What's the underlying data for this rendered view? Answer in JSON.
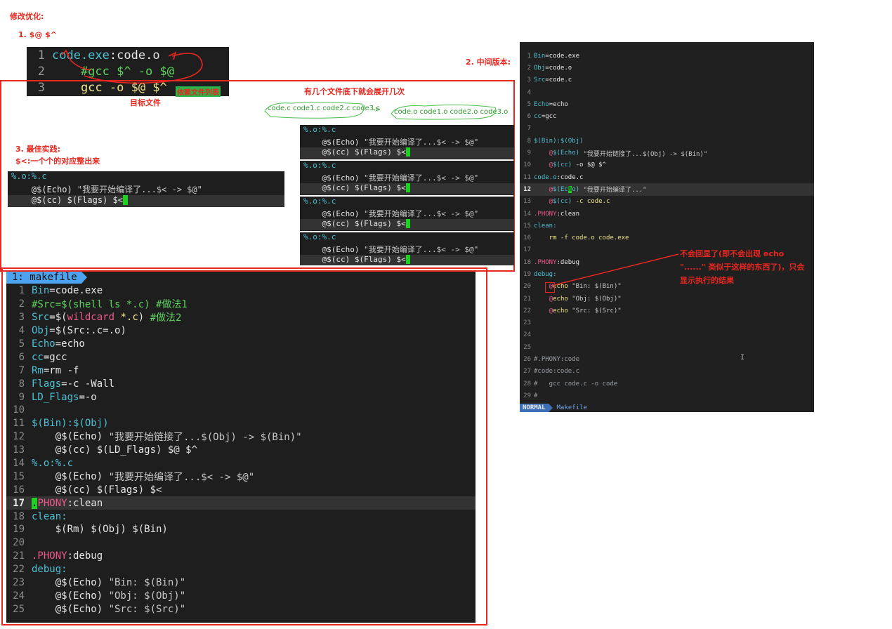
{
  "annotations": {
    "heading": "修改优化:",
    "step1": "1. $@ $^",
    "deps_label": "依赖文件列表",
    "target_label": "目标文件",
    "step2": "2. 中间版本:",
    "expand_note": "有几个文件底下就会展开几次",
    "src_files": "code.c code1.c code2.c code3.c",
    "arrow": "->",
    "obj_files": "code.o code1.o code2.o code3.o",
    "step3": "3. 最佳实践:",
    "step3_sub": "$<:一个个的对应整出来",
    "no_echo_note_1": "不会回显了(即不会出现 echo",
    "no_echo_note_2": "\"......\" 类似于这样的东西了)，只会",
    "no_echo_note_3": "显示执行的结果"
  },
  "snippet1": {
    "lines": [
      {
        "n": "1",
        "a": "code.exe",
        "b": ":",
        "c": "code.o"
      },
      {
        "n": "2",
        "t": "    #gcc $^ -o $@"
      },
      {
        "n": "3",
        "t": "    gcc -o $@ $^"
      }
    ]
  },
  "pattern_block": {
    "l1": "%.o:%.c",
    "l2a": "    @$(Echo) ",
    "l2b": "\"我要开始编译了...$< -> $@\"",
    "l3": "    @$(cc) $(Flags) $<"
  },
  "main_editor": {
    "tab_label": "1: makefile",
    "lines": [
      {
        "n": "1",
        "p": [
          [
            "c-cyan",
            "Bin"
          ],
          [
            "c-white",
            "=code.exe"
          ]
        ]
      },
      {
        "n": "2",
        "p": [
          [
            "c-green",
            "#Src=$(shell ls *.c) #做法1"
          ]
        ]
      },
      {
        "n": "3",
        "p": [
          [
            "c-cyan",
            "Src"
          ],
          [
            "c-white",
            "=$("
          ],
          [
            "c-pink",
            "wildcard"
          ],
          [
            "c-white",
            " "
          ],
          [
            "c-yellow",
            "*.c"
          ],
          [
            "c-white",
            ") "
          ],
          [
            "c-green",
            "#做法2"
          ]
        ]
      },
      {
        "n": "4",
        "p": [
          [
            "c-cyan",
            "Obj"
          ],
          [
            "c-white",
            "=$(Src:.c=.o)"
          ]
        ]
      },
      {
        "n": "5",
        "p": [
          [
            "c-cyan",
            "Echo"
          ],
          [
            "c-white",
            "=echo"
          ]
        ]
      },
      {
        "n": "6",
        "p": [
          [
            "c-cyan",
            "cc"
          ],
          [
            "c-white",
            "=gcc"
          ]
        ]
      },
      {
        "n": "7",
        "p": [
          [
            "c-cyan",
            "Rm"
          ],
          [
            "c-white",
            "=rm -f"
          ]
        ]
      },
      {
        "n": "8",
        "p": [
          [
            "c-cyan",
            "Flags"
          ],
          [
            "c-white",
            "=-c -Wall"
          ]
        ]
      },
      {
        "n": "9",
        "p": [
          [
            "c-cyan",
            "LD_Flags"
          ],
          [
            "c-white",
            "=-o"
          ]
        ]
      },
      {
        "n": "10",
        "p": []
      },
      {
        "n": "11",
        "p": [
          [
            "c-cyan",
            "$(Bin):$(Obj)"
          ]
        ]
      },
      {
        "n": "12",
        "p": [
          [
            "c-white",
            "    @$(Echo) "
          ],
          [
            "c-lt",
            "\"我要开始链接了...$(Obj) -> $(Bin)\""
          ]
        ]
      },
      {
        "n": "13",
        "p": [
          [
            "c-white",
            "    @$(cc) $(LD_Flags) $@ $^"
          ]
        ]
      },
      {
        "n": "14",
        "p": [
          [
            "c-cyan",
            "%.o:%.c"
          ]
        ]
      },
      {
        "n": "15",
        "p": [
          [
            "c-white",
            "    @$(Echo) "
          ],
          [
            "c-lt",
            "\"我要开始编译了...$< -> $@\""
          ]
        ]
      },
      {
        "n": "16",
        "p": [
          [
            "c-white",
            "    @$(cc) $(Flags) $<"
          ]
        ]
      },
      {
        "n": "17",
        "p": [
          [
            "cursor",
            "."
          ],
          [
            "c-pink",
            "PHONY"
          ],
          [
            "c-white",
            ":clean"
          ]
        ],
        "hl": true
      },
      {
        "n": "18",
        "p": [
          [
            "c-cyan",
            "clean:"
          ]
        ]
      },
      {
        "n": "19",
        "p": [
          [
            "c-white",
            "    $(Rm) $(Obj) $(Bin)"
          ]
        ]
      },
      {
        "n": "20",
        "p": []
      },
      {
        "n": "21",
        "p": [
          [
            "c-pink",
            ".PHONY"
          ],
          [
            "c-white",
            ":debug"
          ]
        ]
      },
      {
        "n": "22",
        "p": [
          [
            "c-cyan",
            "debug:"
          ]
        ]
      },
      {
        "n": "23",
        "p": [
          [
            "c-white",
            "    @$(Echo) "
          ],
          [
            "c-lt",
            "\"Bin: $(Bin)\""
          ]
        ]
      },
      {
        "n": "24",
        "p": [
          [
            "c-white",
            "    @$(Echo) "
          ],
          [
            "c-lt",
            "\"Obj: $(Obj)\""
          ]
        ]
      },
      {
        "n": "25",
        "p": [
          [
            "c-white",
            "    @$(Echo) "
          ],
          [
            "c-lt",
            "\"Src: $(Src)\""
          ]
        ]
      }
    ]
  },
  "right_editor": {
    "mode": "NORMAL",
    "filename": "Makefile",
    "lines": [
      {
        "n": "1",
        "p": [
          [
            "c-cyan",
            "Bin"
          ],
          [
            "c-white",
            "=code.exe"
          ]
        ]
      },
      {
        "n": "2",
        "p": [
          [
            "c-cyan",
            "Obj"
          ],
          [
            "c-white",
            "=code.o"
          ]
        ]
      },
      {
        "n": "3",
        "p": [
          [
            "c-cyan",
            "Src"
          ],
          [
            "c-white",
            "=code.c"
          ]
        ]
      },
      {
        "n": "4",
        "p": []
      },
      {
        "n": "5",
        "p": [
          [
            "c-cyan",
            "Echo"
          ],
          [
            "c-white",
            "=echo"
          ]
        ]
      },
      {
        "n": "6",
        "p": [
          [
            "c-cyan",
            "cc"
          ],
          [
            "c-white",
            "=gcc"
          ]
        ]
      },
      {
        "n": "7",
        "p": []
      },
      {
        "n": "8",
        "p": [
          [
            "c-cyan",
            "$(Bin):$(Obj)"
          ]
        ]
      },
      {
        "n": "9",
        "p": [
          [
            "c-white",
            "    "
          ],
          [
            "c-pink",
            "@"
          ],
          [
            "c-cyan",
            "$(Echo)"
          ],
          [
            "c-lt",
            " \"我要开始链接了...$(Obj) -> $(Bin)\""
          ]
        ]
      },
      {
        "n": "10",
        "p": [
          [
            "c-white",
            "    "
          ],
          [
            "c-pink",
            "@"
          ],
          [
            "c-cyan",
            "$(cc)"
          ],
          [
            "c-white",
            " -o $@ $^"
          ]
        ]
      },
      {
        "n": "11",
        "p": [
          [
            "c-cyan",
            "code.o"
          ],
          [
            "c-white",
            ":code.c"
          ]
        ]
      },
      {
        "n": "12",
        "p": [
          [
            "c-white",
            "    "
          ],
          [
            "c-pink",
            "@"
          ],
          [
            "c-cyan",
            "$(Ec"
          ],
          [
            "cursor",
            "h"
          ],
          [
            "c-cyan",
            "o)"
          ],
          [
            "c-lt",
            " \"我要开始编译了...\""
          ]
        ],
        "hl": true
      },
      {
        "n": "13",
        "p": [
          [
            "c-white",
            "    "
          ],
          [
            "c-pink",
            "@"
          ],
          [
            "c-cyan",
            "$(cc)"
          ],
          [
            "c-yellow",
            " -c code.c"
          ]
        ]
      },
      {
        "n": "14",
        "p": [
          [
            "c-pink",
            ".PHONY"
          ],
          [
            "c-white",
            ":clean"
          ]
        ]
      },
      {
        "n": "15",
        "p": [
          [
            "c-cyan",
            "clean:"
          ]
        ]
      },
      {
        "n": "16",
        "p": [
          [
            "c-yellow",
            "    rm -f code.o code.exe"
          ]
        ]
      },
      {
        "n": "17",
        "p": []
      },
      {
        "n": "18",
        "p": [
          [
            "c-pink",
            ".PHONY"
          ],
          [
            "c-white",
            ":debug"
          ]
        ]
      },
      {
        "n": "19",
        "p": [
          [
            "c-cyan",
            "debug:"
          ]
        ]
      },
      {
        "n": "20",
        "p": [
          [
            "c-white",
            "    "
          ],
          [
            "c-pink",
            "@"
          ],
          [
            "c-yellow",
            "echo"
          ],
          [
            "c-lt",
            " \"Bin: $(Bin)\""
          ]
        ]
      },
      {
        "n": "21",
        "p": [
          [
            "c-white",
            "    "
          ],
          [
            "c-pink",
            "@"
          ],
          [
            "c-yellow",
            "echo"
          ],
          [
            "c-lt",
            " \"Obj: $(Obj)\""
          ]
        ]
      },
      {
        "n": "22",
        "p": [
          [
            "c-white",
            "    "
          ],
          [
            "c-pink",
            "@"
          ],
          [
            "c-yellow",
            "echo"
          ],
          [
            "c-lt",
            " \"Src: $(Src)\""
          ]
        ]
      },
      {
        "n": "23",
        "p": []
      },
      {
        "n": "24",
        "p": []
      },
      {
        "n": "25",
        "p": []
      },
      {
        "n": "26",
        "p": [
          [
            "c-dim",
            "#.PHONY:code"
          ]
        ]
      },
      {
        "n": "27",
        "p": [
          [
            "c-dim",
            "#code:code.c"
          ]
        ]
      },
      {
        "n": "28",
        "p": [
          [
            "c-dim",
            "#   gcc code.c -o code"
          ]
        ]
      },
      {
        "n": "29",
        "p": [
          [
            "c-dim",
            "#"
          ]
        ]
      }
    ]
  },
  "colors": {
    "annotation_red": "#e8271f",
    "terminal_bg": "#1e1e1e",
    "cursor_green": "#20d020"
  }
}
